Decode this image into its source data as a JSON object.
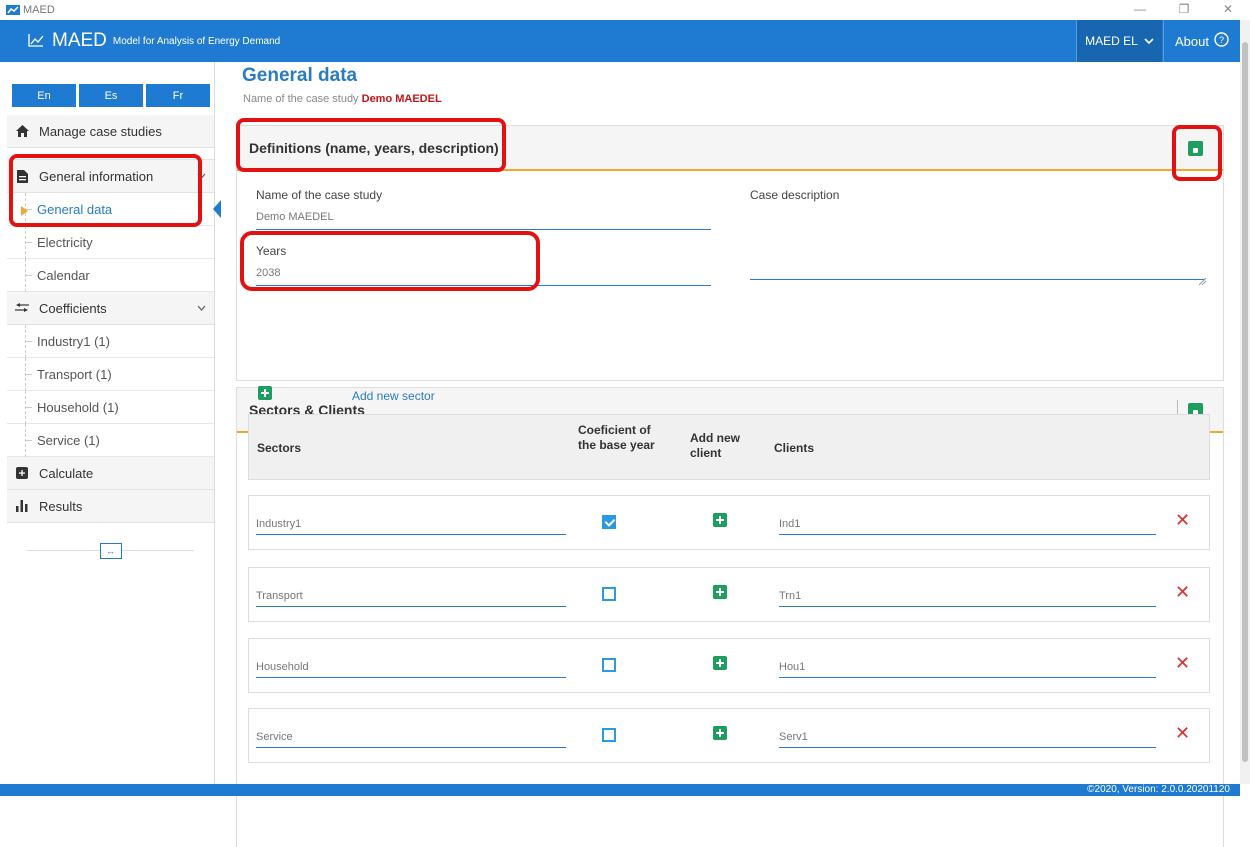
{
  "window": {
    "title": "MAED",
    "minimize": "—",
    "maximize": "❐",
    "close": "✕"
  },
  "appbar": {
    "brand": "MAED",
    "tagline": "Model for Analysis of Energy Demand",
    "module": "MAED EL",
    "about": "About"
  },
  "languages": [
    "En",
    "Es",
    "Fr"
  ],
  "sidebar": {
    "manage": "Manage case studies",
    "general_information": "General information",
    "general_items": [
      "General data",
      "Electricity",
      "Calendar"
    ],
    "coefficients": "Coefficients",
    "coefficient_items": [
      "Industry1 (1)",
      "Transport (1)",
      "Household (1)",
      "Service (1)"
    ],
    "calculate": "Calculate",
    "results": "Results",
    "collapse_icon": "↔"
  },
  "page": {
    "title": "General data",
    "subtitle_prefix": "Name of the case study",
    "case_name": "Demo MAEDEL"
  },
  "definitions": {
    "header": "Definitions (name, years, description)",
    "name_label": "Name of the case study",
    "name_value": "Demo MAEDEL",
    "years_label": "Years",
    "years_value": "2038",
    "desc_label": "Case description",
    "desc_value": ""
  },
  "sectors": {
    "header": "Sectors & Clients",
    "add_sector": "Add new sector",
    "columns": {
      "sectors": "Sectors",
      "coef": "Coeficient of the base year",
      "add_client": "Add new client",
      "clients": "Clients"
    },
    "rows": [
      {
        "sector": "Industry1",
        "base_year": true,
        "client": "Ind1"
      },
      {
        "sector": "Transport",
        "base_year": false,
        "client": "Trn1"
      },
      {
        "sector": "Household",
        "base_year": false,
        "client": "Hou1"
      },
      {
        "sector": "Service",
        "base_year": false,
        "client": "Serv1"
      }
    ],
    "delete_glyph": "✕"
  },
  "footer": {
    "text": "©2020, Version: 2.0.0.20201120"
  },
  "colors": {
    "primary": "#1f7bd1",
    "accent": "#f0a830",
    "save": "#1e9e5e",
    "annotation": "#e21212"
  }
}
